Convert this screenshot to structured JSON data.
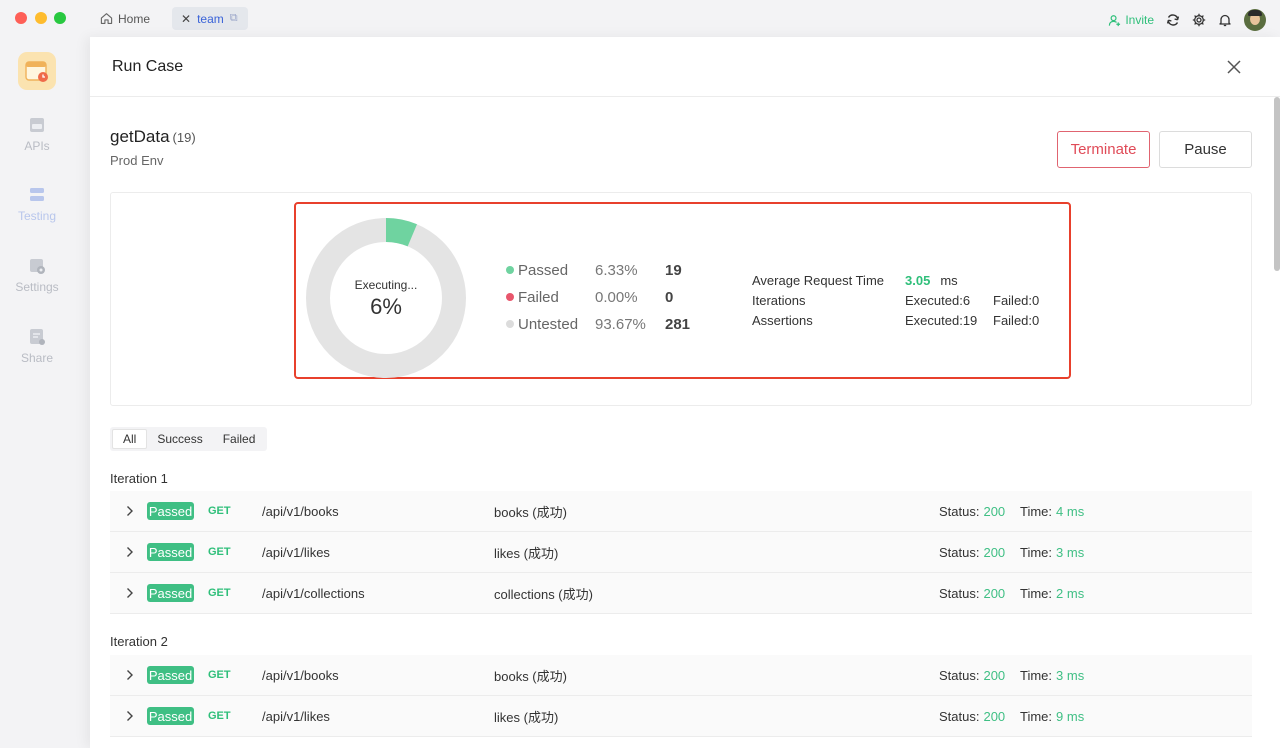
{
  "titlebar": {
    "tabs": [
      {
        "label": "Home"
      },
      {
        "label": "team"
      }
    ],
    "invite_label": "Invite"
  },
  "sidenav": {
    "items": [
      {
        "label": "APIs"
      },
      {
        "label": "Testing"
      },
      {
        "label": "Settings"
      },
      {
        "label": "Share"
      }
    ]
  },
  "panel": {
    "title": "Run Case",
    "case_name": "getData",
    "case_count": "(19)",
    "env": "Prod Env",
    "terminate_label": "Terminate",
    "pause_label": "Pause"
  },
  "summary": {
    "executing_label": "Executing...",
    "progress_percent": "6%",
    "progress_fraction": 0.0633,
    "legend": [
      {
        "label": "Passed",
        "percent": "6.33%",
        "count": "19",
        "color": "#6fd3a0"
      },
      {
        "label": "Failed",
        "percent": "0.00%",
        "count": "0",
        "color": "#e8566c"
      },
      {
        "label": "Untested",
        "percent": "93.67%",
        "count": "281",
        "color": "#dcdcdc"
      }
    ],
    "avg_request_label": "Average Request Time",
    "avg_request_value": "3.05",
    "avg_request_unit": "ms",
    "iterations_label": "Iterations",
    "iterations_executed": "Executed:6",
    "iterations_failed": "Failed:0",
    "assertions_label": "Assertions",
    "assertions_executed": "Executed:19",
    "assertions_failed": "Failed:0"
  },
  "filters": [
    "All",
    "Success",
    "Failed"
  ],
  "iterations": [
    {
      "title": "Iteration 1",
      "rows": [
        {
          "badge": "Passed",
          "method": "GET",
          "path": "/api/v1/books",
          "desc": "books (成功)",
          "status_label": "Status:",
          "status": "200",
          "time_label": "Time:",
          "time": "4 ms"
        },
        {
          "badge": "Passed",
          "method": "GET",
          "path": "/api/v1/likes",
          "desc": "likes (成功)",
          "status_label": "Status:",
          "status": "200",
          "time_label": "Time:",
          "time": "3 ms"
        },
        {
          "badge": "Passed",
          "method": "GET",
          "path": "/api/v1/collections",
          "desc": "collections (成功)",
          "status_label": "Status:",
          "status": "200",
          "time_label": "Time:",
          "time": "2 ms"
        }
      ]
    },
    {
      "title": "Iteration 2",
      "rows": [
        {
          "badge": "Passed",
          "method": "GET",
          "path": "/api/v1/books",
          "desc": "books (成功)",
          "status_label": "Status:",
          "status": "200",
          "time_label": "Time:",
          "time": "3 ms"
        },
        {
          "badge": "Passed",
          "method": "GET",
          "path": "/api/v1/likes",
          "desc": "likes (成功)",
          "status_label": "Status:",
          "status": "200",
          "time_label": "Time:",
          "time": "9 ms"
        }
      ]
    }
  ]
}
